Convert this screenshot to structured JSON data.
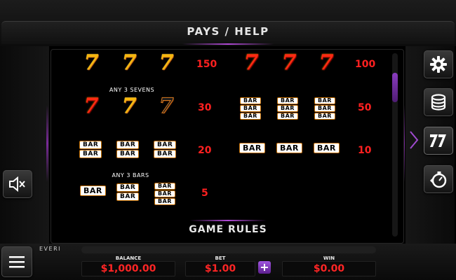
{
  "header": {
    "title": "PAYS / HELP"
  },
  "paytable": {
    "row1": {
      "left_value": "150",
      "right_value": "100"
    },
    "row2": {
      "note": "ANY 3 SEVENS",
      "left_value": "30",
      "right_value": "50"
    },
    "row3": {
      "left_value": "20",
      "right_value": "10"
    },
    "row4": {
      "note": "ANY 3 BARS",
      "left_value": "5"
    },
    "bar_label": "BAR"
  },
  "rules_title": "GAME RULES",
  "brand": "EVERI",
  "footer": {
    "balance_label": "BALANCE",
    "balance_value": "$1,000.00",
    "bet_label": "BET",
    "bet_value": "$1.00",
    "bet_plus": "+",
    "win_label": "WIN",
    "win_value": "$0.00"
  },
  "sevens_symbol": "7",
  "icons": {
    "settings": "gear-icon",
    "coins": "coin-stack-icon",
    "paytable": "sevens-icon",
    "autoplay": "stopwatch-icon",
    "sound": "speaker-muted-icon",
    "menu": "hamburger-icon"
  },
  "colors": {
    "accent": "#8a3cc0",
    "payout": "#ff2020",
    "gold_seven": "#f7b70c",
    "red_seven": "#ff2a12"
  }
}
